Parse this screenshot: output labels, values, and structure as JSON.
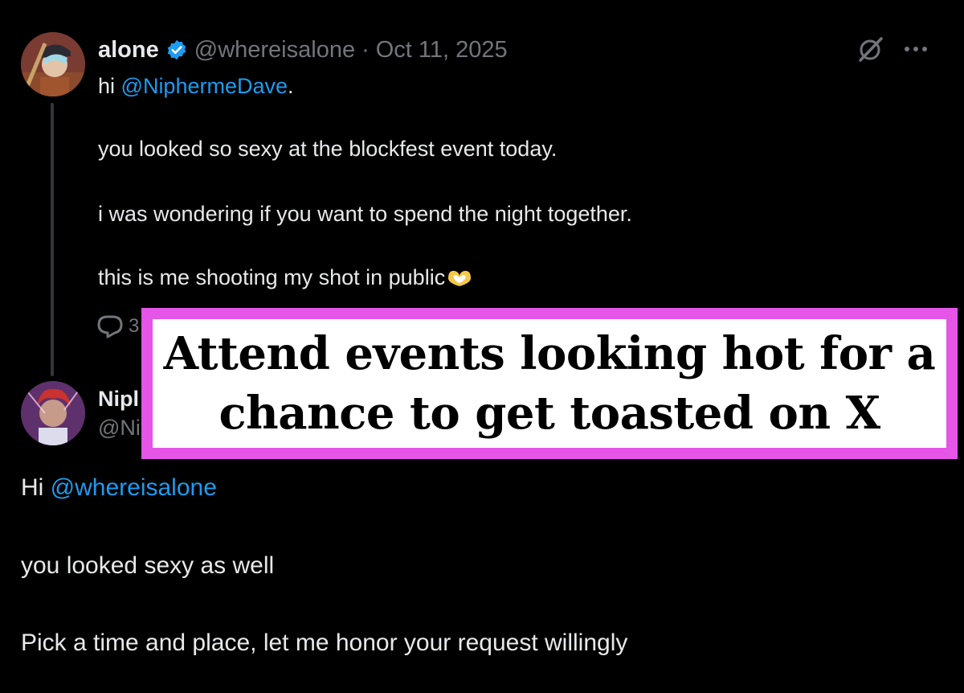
{
  "colors": {
    "background": "#000000",
    "text": "#e7e9ea",
    "muted": "#71767b",
    "link": "#1d9bf0",
    "verified": "#1d9bf0",
    "overlay_border": "#e455e8",
    "overlay_bg": "#ffffff"
  },
  "tweet": {
    "display_name": "alone",
    "handle": "@whereisalone",
    "separator": "·",
    "date": "Oct 11, 2025",
    "icons": [
      "avatar",
      "verified-badge-icon",
      "grok-icon",
      "more-options-icon",
      "reply-icon",
      "heart-hands-emoji"
    ],
    "greeting": "hi ",
    "mention": "@NiphermeDave",
    "greeting_end": ".",
    "line_2": "you looked so sexy at the blockfest event today.",
    "line_3": "i was wondering if you want to spend the night together.",
    "line_4": "this is me shooting my shot in public",
    "reply_count": "3"
  },
  "reply": {
    "display_name_partial": "Nipl",
    "handle_partial": "@Ni",
    "greeting": "Hi ",
    "mention": "@whereisalone",
    "line_2": "you looked sexy as well",
    "line_3": "Pick a time and place, let me honor your request willingly"
  },
  "overlay": {
    "line_1": "Attend events looking hot for a",
    "line_2": "chance to get toasted on X"
  }
}
